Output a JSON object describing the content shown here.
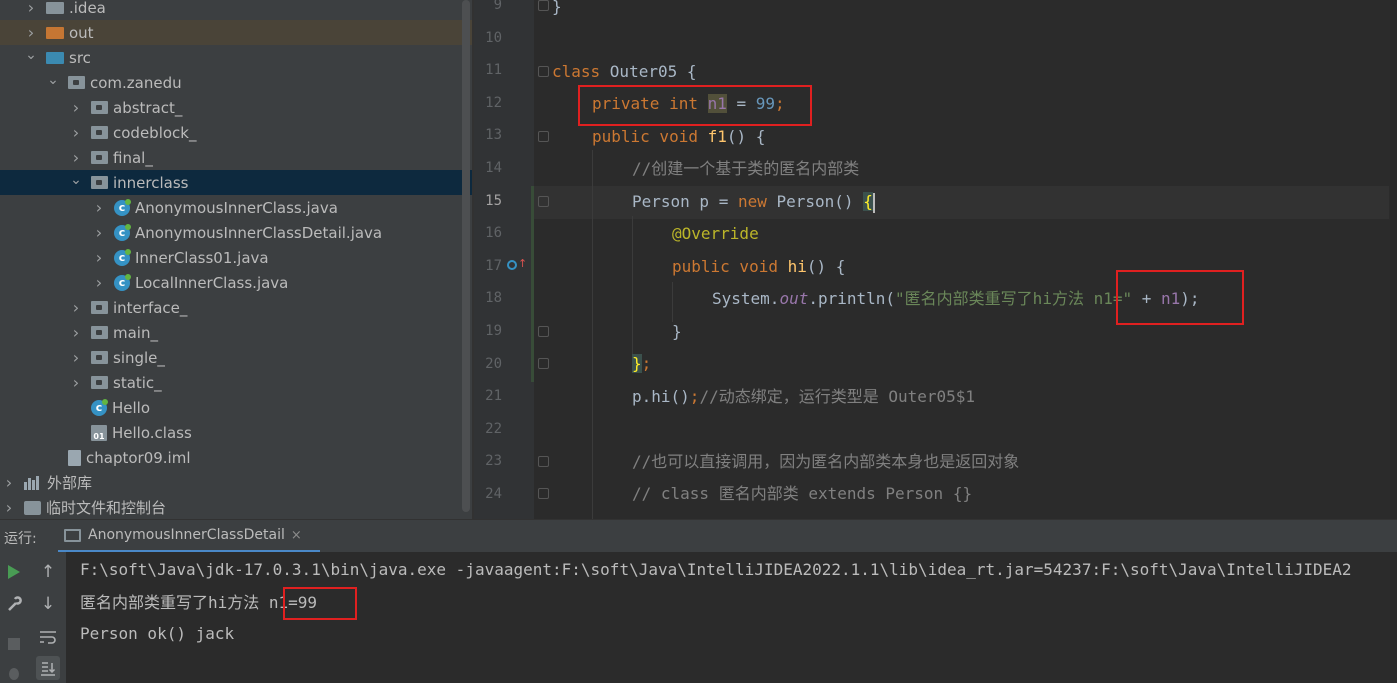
{
  "project_tree": [
    {
      "label": ".idea",
      "arrow": "right",
      "icon": "folder-icon",
      "depth": 1
    },
    {
      "label": "out",
      "arrow": "right",
      "icon": "folder-orange-icon",
      "depth": 1
    },
    {
      "label": "src",
      "arrow": "down",
      "icon": "folder-blue-icon",
      "depth": 1
    },
    {
      "label": "com.zanedu",
      "arrow": "down",
      "icon": "package-icon",
      "depth": 2
    },
    {
      "label": "abstract_",
      "arrow": "right",
      "icon": "package-icon",
      "depth": 3
    },
    {
      "label": "codeblock_",
      "arrow": "right",
      "icon": "package-icon",
      "depth": 3
    },
    {
      "label": "final_",
      "arrow": "right",
      "icon": "package-icon",
      "depth": 3
    },
    {
      "label": "innerclass",
      "arrow": "down",
      "icon": "package-icon",
      "depth": 3
    },
    {
      "label": "AnonymousInnerClass.java",
      "arrow": "right",
      "icon": "java-class-icon",
      "depth": 4
    },
    {
      "label": "AnonymousInnerClassDetail.java",
      "arrow": "right",
      "icon": "java-class-icon",
      "depth": 4
    },
    {
      "label": "InnerClass01.java",
      "arrow": "right",
      "icon": "java-class-icon",
      "depth": 4
    },
    {
      "label": "LocalInnerClass.java",
      "arrow": "right",
      "icon": "java-class-icon",
      "depth": 4
    },
    {
      "label": "interface_",
      "arrow": "right",
      "icon": "package-icon",
      "depth": 3
    },
    {
      "label": "main_",
      "arrow": "right",
      "icon": "package-icon",
      "depth": 3
    },
    {
      "label": "single_",
      "arrow": "right",
      "icon": "package-icon",
      "depth": 3
    },
    {
      "label": "static_",
      "arrow": "right",
      "icon": "package-icon",
      "depth": 3
    },
    {
      "label": "Hello",
      "arrow": "none",
      "icon": "java-class-icon",
      "depth": 3
    },
    {
      "label": "Hello.class",
      "arrow": "none",
      "icon": "class-file-icon",
      "depth": 3
    },
    {
      "label": "chaptor09.iml",
      "arrow": "none",
      "icon": "iml-file-icon",
      "depth": 2
    },
    {
      "label": "外部库",
      "arrow": "right",
      "icon": "library-icon",
      "depth": 0
    },
    {
      "label": "临时文件和控制台",
      "arrow": "right",
      "icon": "scratch-icon",
      "depth": 0
    }
  ],
  "editor": {
    "line_numbers": [
      "9",
      "10",
      "11",
      "12",
      "13",
      "14",
      "15",
      "16",
      "17",
      "18",
      "19",
      "20",
      "21",
      "22",
      "23",
      "24"
    ],
    "current_line": "15",
    "lines": {
      "l9": "}",
      "l11_kw": "class ",
      "l11_rest": "Outer05 {",
      "l12_kw": "private int ",
      "l12_var": "n1",
      "l12_eq": " = ",
      "l12_num": "99",
      "l12_semi": ";",
      "l13_kw": "public void ",
      "l13_fn": "f1",
      "l13_rest": "() {",
      "l14_cmt": "//创建一个基于类的匿名内部类",
      "l15_a": "Person p = ",
      "l15_kw": "new ",
      "l15_b": "Person() ",
      "l15_brace": "{",
      "l16_ann": "@Override",
      "l17_kw": "public void ",
      "l17_fn": "hi",
      "l17_rest": "() {",
      "l18_a": "System.",
      "l18_out": "out",
      "l18_b": ".println(",
      "l18_str": "\"匿名内部类重写了hi方法 n1=\"",
      "l18_c": " + ",
      "l18_fld": "n1",
      "l18_d": ");",
      "l19": "}",
      "l20_brace": "}",
      "l20_semi": ";",
      "l21_a": "p.hi()",
      "l21_semi": ";",
      "l21_cmt": "//动态绑定，运行类型是 Outer05$1",
      "l23_cmt": "//也可以直接调用，因为匿名内部类本身也是返回对象",
      "l24_cmt": "// class 匿名内部类 extends Person {}"
    }
  },
  "run_panel": {
    "label": "运行:",
    "tab_title": "AnonymousInnerClassDetail",
    "tab_close": "×",
    "output": [
      "F:\\soft\\Java\\jdk-17.0.3.1\\bin\\java.exe -javaagent:F:\\soft\\Java\\IntelliJIDEA2022.1.1\\lib\\idea_rt.jar=54237:F:\\soft\\Java\\IntelliJIDEA2",
      "匿名内部类重写了hi方法 n1=99",
      "Person ok() jack"
    ]
  }
}
